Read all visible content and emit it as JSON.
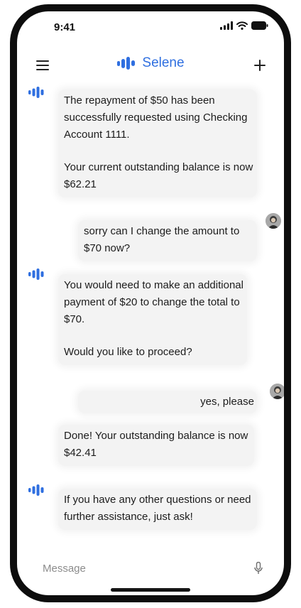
{
  "status_bar": {
    "time": "9:41",
    "icons": [
      "signal-icon",
      "wifi-icon",
      "battery-icon"
    ]
  },
  "header": {
    "title": "Selene",
    "brand_color": "#2f6fe0",
    "menu_icon": "menu-icon",
    "add_icon": "plus-icon"
  },
  "messages": [
    {
      "sender": "assistant",
      "paragraphs": [
        "The repayment of $50 has been successfully requested using Checking Account 1111.",
        "Your current outstanding balance is now $62.21"
      ]
    },
    {
      "sender": "user",
      "paragraphs": [
        "sorry can I change the amount to $70 now?"
      ]
    },
    {
      "sender": "assistant",
      "paragraphs": [
        "You would need to make an additional payment of $20 to change the total to $70.",
        "Would you like to proceed?"
      ]
    },
    {
      "sender": "user",
      "paragraphs": [
        "yes, please"
      ]
    },
    {
      "sender": "assistant",
      "paragraphs": [
        "Done! Your outstanding balance is now $42.41"
      ]
    },
    {
      "sender": "assistant",
      "paragraphs": [
        "If you have any other questions or need further assistance, just ask!"
      ]
    }
  ],
  "composer": {
    "placeholder": "Message",
    "value": "",
    "mic_icon": "microphone-icon"
  }
}
